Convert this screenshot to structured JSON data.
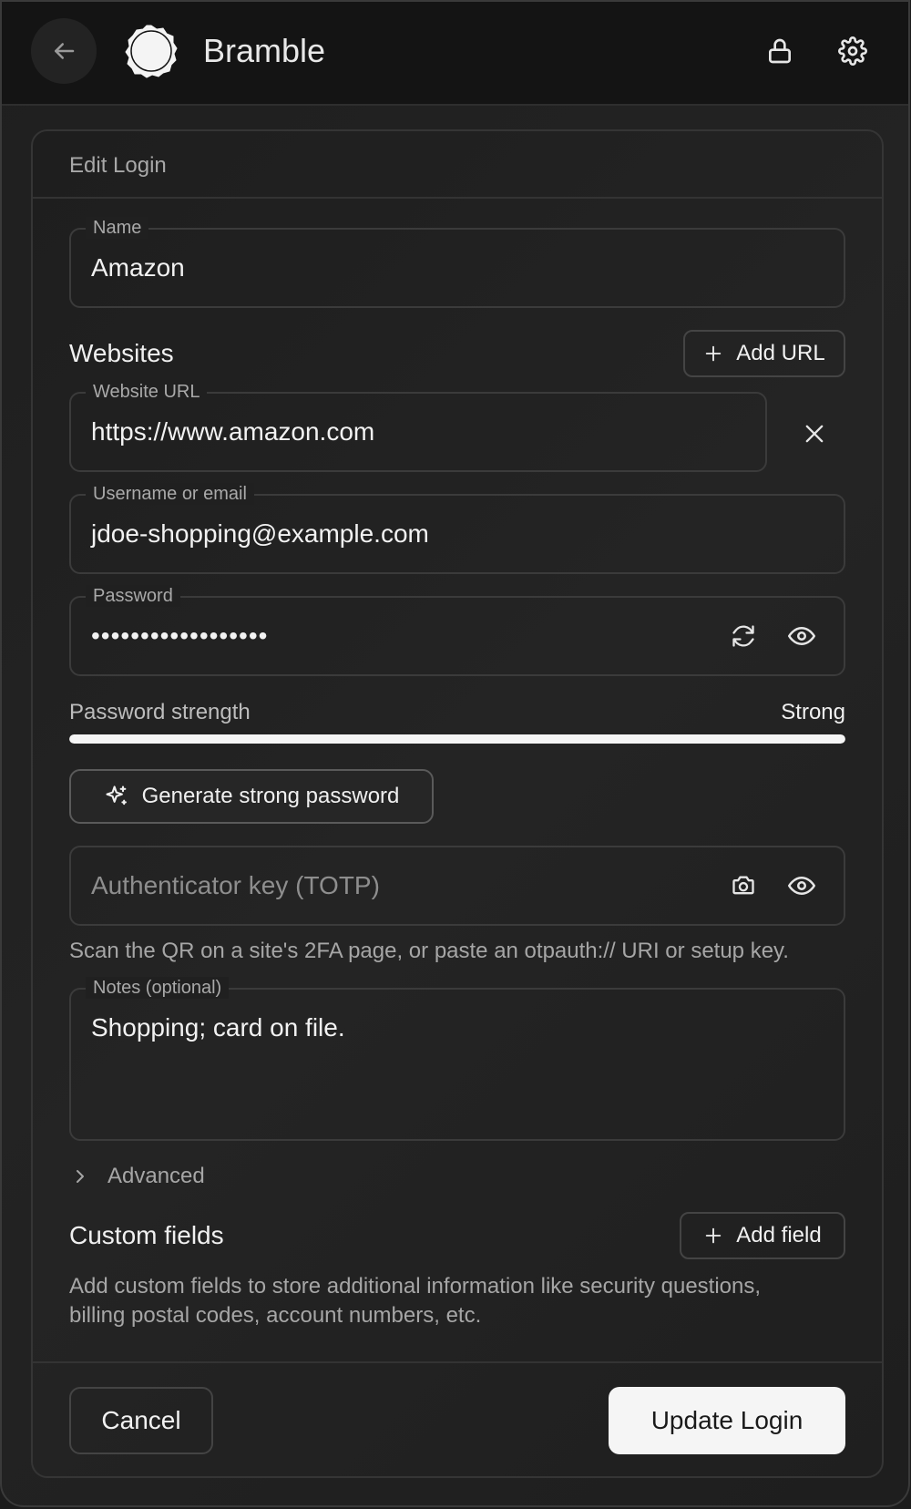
{
  "header": {
    "title": "Bramble",
    "icons": {
      "back": "arrow-left-icon",
      "logo": "bramble-logo",
      "lock": "lock-icon",
      "settings": "gear-icon"
    }
  },
  "card": {
    "title": "Edit Login"
  },
  "name_field": {
    "label": "Name",
    "value": "Amazon"
  },
  "websites": {
    "label": "Websites",
    "add_label": "Add URL",
    "url_field": {
      "label": "Website URL",
      "value": "https://www.amazon.com"
    }
  },
  "username_field": {
    "label": "Username or email",
    "value": "jdoe-shopping@example.com"
  },
  "password_field": {
    "label": "Password",
    "value": "••••••••••••••••••"
  },
  "strength": {
    "label": "Password strength",
    "value": "Strong",
    "level": 1.0
  },
  "generate_label": "Generate strong password",
  "totp": {
    "placeholder": "Authenticator key (TOTP)",
    "help": "Scan the QR on a site's 2FA page, or paste an otpauth:// URI or setup key."
  },
  "notes_field": {
    "label": "Notes (optional)",
    "value": "Shopping; card on file."
  },
  "advanced_label": "Advanced",
  "custom_fields": {
    "label": "Custom fields",
    "add_label": "Add field",
    "help": "Add custom fields to store additional information like security questions, billing postal codes, account numbers, etc."
  },
  "footer": {
    "cancel_label": "Cancel",
    "submit_label": "Update Login"
  },
  "colors": {
    "background": "#1c1c1c",
    "primary_button": "#f5f5f5",
    "strength_bar": "#f5f5f5"
  }
}
